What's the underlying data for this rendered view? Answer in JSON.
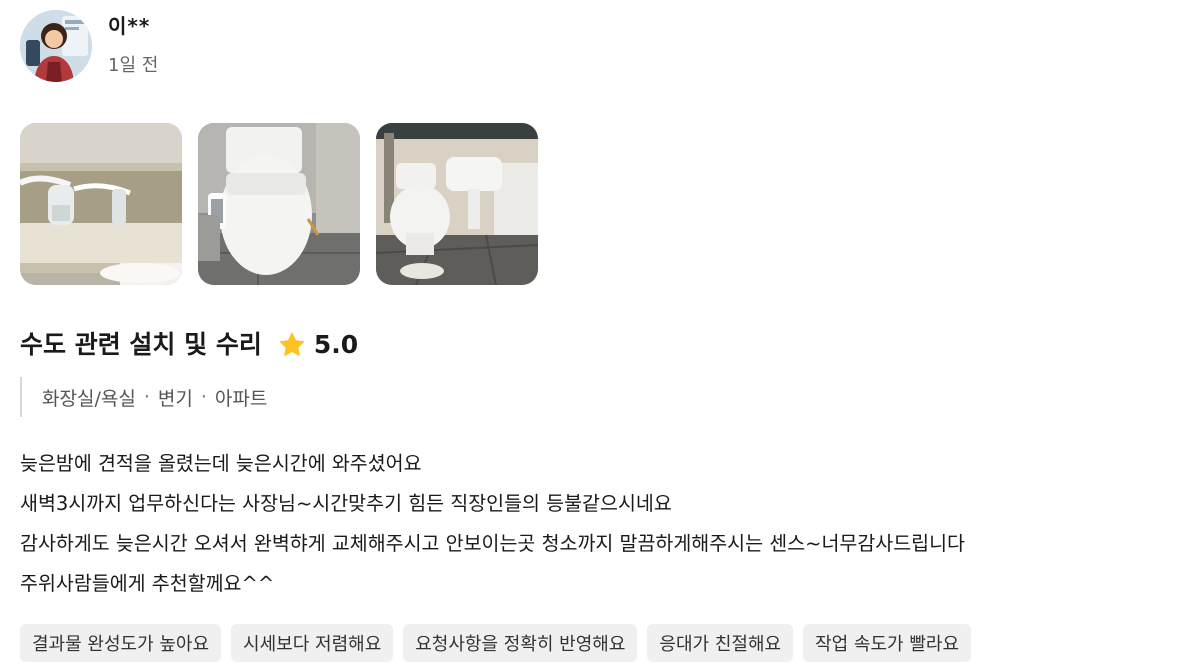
{
  "user": {
    "name": "이**",
    "time": "1일 전"
  },
  "photos": [
    {
      "icon": "toilet-tank-photo"
    },
    {
      "icon": "bidet-toilet-photo"
    },
    {
      "icon": "bathroom-photo"
    }
  ],
  "service": {
    "title": "수도 관련 설치 및 수리",
    "rating": "5.0",
    "star_color": "#FFC224"
  },
  "categories": [
    "화장실/욕실",
    "변기",
    "아파트"
  ],
  "category_separator": "·",
  "body": [
    "늦은밤에 견적을 올렸는데 늦은시간에 와주셨어요",
    "새벽3시까지 업무하신다는 사장님~시간맞추기 힘든 직장인들의 등불같으시네요",
    "감사하게도 늦은시간 오셔서 완벽햐게 교체해주시고 안보이는곳 청소까지 말끔하게해주시는 센스~너무감사드립니다",
    "주위사람들에게 추천할께요^^"
  ],
  "chips": [
    "결과물 완성도가 높아요",
    "시세보다 저렴해요",
    "요청사항을 정확히 반영해요",
    "응대가 친절해요",
    "작업 속도가 빨라요"
  ]
}
